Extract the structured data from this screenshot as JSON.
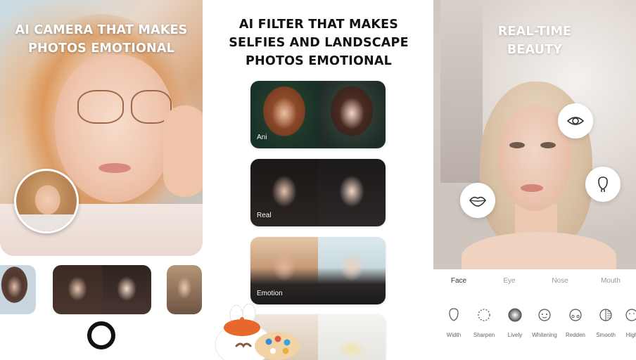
{
  "panel1": {
    "headline": "AI CAMERA THAT MAKES\nPHOTOS EMOTIONAL"
  },
  "panel2": {
    "headline": "AI FILTER THAT MAKES\nSELFIES AND LANDSCAPE\nPHOTOS EMOTIONAL",
    "filters": [
      {
        "label": "Ani"
      },
      {
        "label": "Real"
      },
      {
        "label": "Emotion"
      },
      {
        "label": ""
      }
    ]
  },
  "panel3": {
    "headline": "REAL-TIME\nBEAUTY",
    "feature_icons": [
      "eye-icon",
      "lips-icon",
      "face-contour-icon"
    ],
    "tabs": [
      {
        "label": "Face",
        "active": true
      },
      {
        "label": "Eye",
        "active": false
      },
      {
        "label": "Nose",
        "active": false
      },
      {
        "label": "Mouth",
        "active": false
      }
    ],
    "tools": [
      {
        "label": "Width"
      },
      {
        "label": "Sharpen"
      },
      {
        "label": "Lively"
      },
      {
        "label": "Whitening"
      },
      {
        "label": "Redden"
      },
      {
        "label": "Smooth"
      },
      {
        "label": "High"
      }
    ]
  }
}
